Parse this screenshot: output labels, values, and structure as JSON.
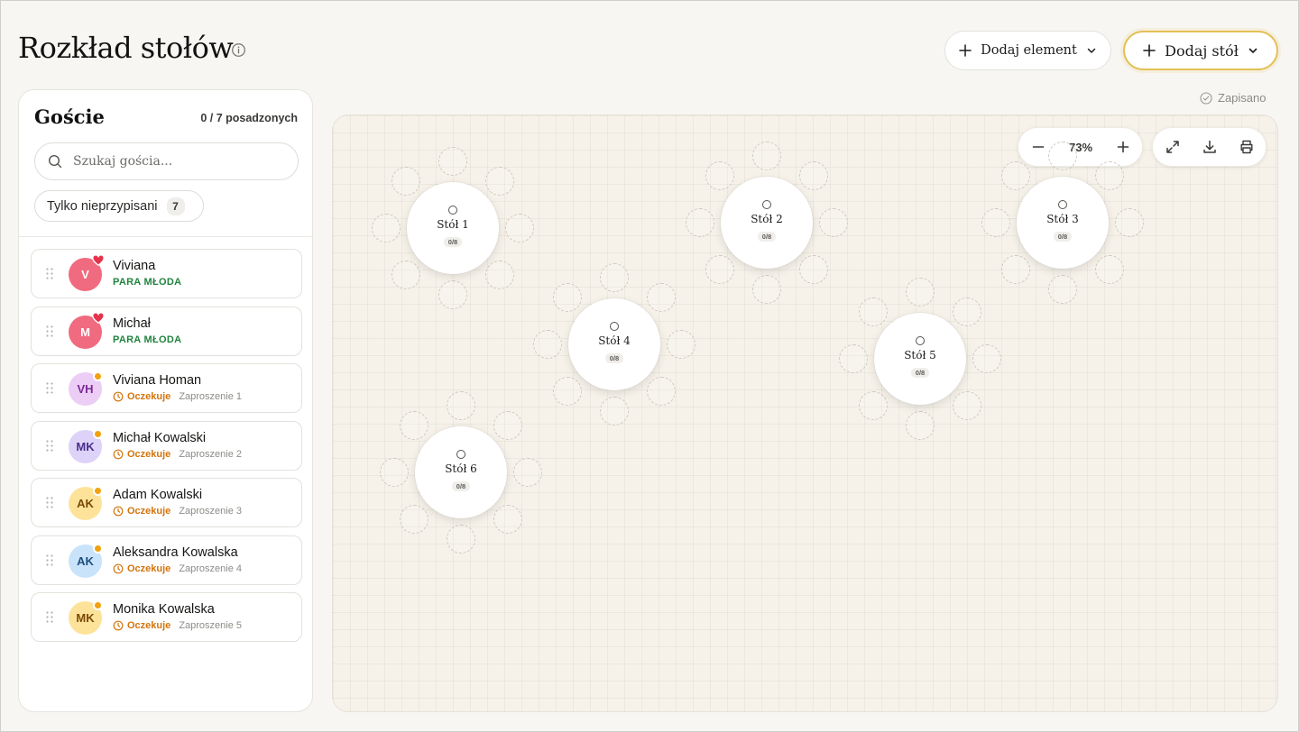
{
  "header": {
    "title": "Rozkład stołów",
    "add_element_label": "Dodaj element",
    "add_table_label": "Dodaj stół",
    "save_status": "Zapisano"
  },
  "sidebar": {
    "title": "Goście",
    "seated_count": "0 / 7 posadzonych",
    "search_placeholder": "Szukaj gościa...",
    "filter_label": "Tylko nieprzypisani",
    "filter_count": "7",
    "guests": [
      {
        "initials": "V",
        "name": "Viviana",
        "role": "PARA MŁODA",
        "badge": "heart",
        "avatar_bg": "#f06b7f",
        "avatar_fg": "#ffffff"
      },
      {
        "initials": "M",
        "name": "Michał",
        "role": "PARA MŁODA",
        "badge": "heart",
        "avatar_bg": "#f06b7f",
        "avatar_fg": "#ffffff"
      },
      {
        "initials": "VH",
        "name": "Viviana Homan",
        "status": "Oczekuje",
        "invite": "Zaproszenie 1",
        "badge": "dot",
        "avatar_bg": "#eccdf6",
        "avatar_fg": "#7a2b92"
      },
      {
        "initials": "MK",
        "name": "Michał Kowalski",
        "status": "Oczekuje",
        "invite": "Zaproszenie 2",
        "badge": "dot",
        "avatar_bg": "#ddd2f8",
        "avatar_fg": "#4b2e8c"
      },
      {
        "initials": "AK",
        "name": "Adam Kowalski",
        "status": "Oczekuje",
        "invite": "Zaproszenie 3",
        "badge": "dot",
        "avatar_bg": "#fde39a",
        "avatar_fg": "#7a4a06"
      },
      {
        "initials": "AK",
        "name": "Aleksandra Kowalska",
        "status": "Oczekuje",
        "invite": "Zaproszenie 4",
        "badge": "dot",
        "avatar_bg": "#c9e3fb",
        "avatar_fg": "#1d4e7f"
      },
      {
        "initials": "MK",
        "name": "Monika Kowalska",
        "status": "Oczekuje",
        "invite": "Zaproszenie 5",
        "badge": "dot",
        "avatar_bg": "#fde39a",
        "avatar_fg": "#7a4a06"
      }
    ]
  },
  "canvas": {
    "zoom": "73%",
    "tables": [
      {
        "name": "Stół 1",
        "capacity": "0/8"
      },
      {
        "name": "Stół 2",
        "capacity": "0/8"
      },
      {
        "name": "Stół 3",
        "capacity": "0/8"
      },
      {
        "name": "Stół 4",
        "capacity": "0/8"
      },
      {
        "name": "Stół 5",
        "capacity": "0/8"
      },
      {
        "name": "Stół 6",
        "capacity": "0/8"
      }
    ]
  },
  "colors": {
    "accent_gold": "#e3bf55",
    "bride_groom_green": "#22833f",
    "pending_orange": "#d4740b",
    "heart_red": "#e5334b"
  },
  "icons": [
    "info-icon",
    "plus-icon",
    "chevron-down-icon",
    "check-circle-icon",
    "search-icon",
    "drag-handle-icon",
    "heart-icon",
    "clock-icon",
    "minus-icon",
    "expand-icon",
    "download-icon",
    "print-icon"
  ]
}
